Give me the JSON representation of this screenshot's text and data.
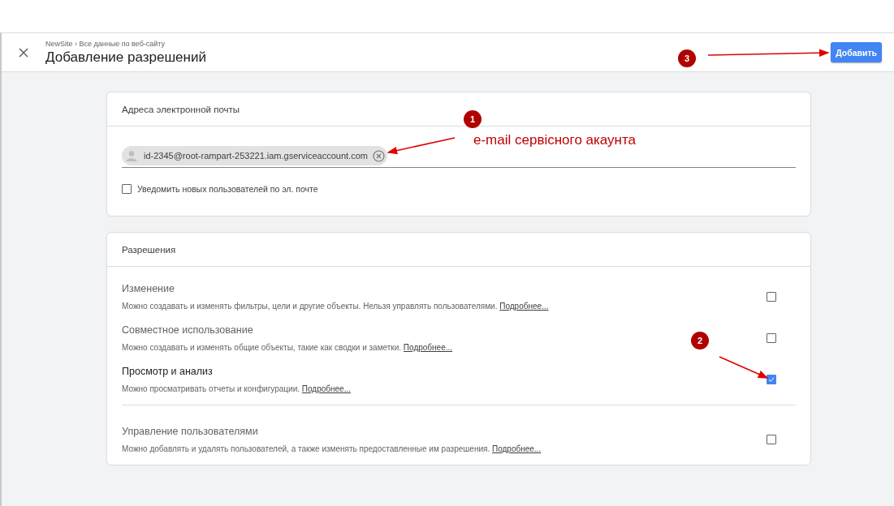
{
  "header": {
    "breadcrumb": "NewSite › Все данные по веб-сайту",
    "title": "Добавление разрешений",
    "add_button": "Добавить"
  },
  "email_card": {
    "title": "Адреса электронной почты",
    "chips": [
      "id-2345@root-rampart-253221.iam.gserviceaccount.com"
    ],
    "notify": {
      "label": "Уведомить новых пользователей по эл. почте",
      "checked": false
    }
  },
  "permissions_card": {
    "title": "Разрешения",
    "groups": [
      {
        "items": [
          {
            "title": "Изменение",
            "description": "Можно создавать и изменять фильтры, цели и другие объекты. Нельзя управлять пользователями.",
            "link": "Подробнее...",
            "checked": false
          },
          {
            "title": "Совместное использование",
            "description": "Можно создавать и изменять общие объекты, такие как сводки и заметки.",
            "link": "Подробнее...",
            "checked": false
          },
          {
            "title": "Просмотр и анализ",
            "description": "Можно просматривать отчеты и конфигурации.",
            "link": "Подробнее...",
            "checked": true
          }
        ]
      },
      {
        "items": [
          {
            "title": "Управление пользователями",
            "description": "Можно добавлять и удалять пользователей, а также изменять предоставленные им разрешения.",
            "link": "Подробнее...",
            "checked": false
          }
        ]
      }
    ]
  },
  "annotations": [
    {
      "number": "1",
      "note": "e-mail сервісного акаунта"
    },
    {
      "number": "2"
    },
    {
      "number": "3"
    }
  ]
}
